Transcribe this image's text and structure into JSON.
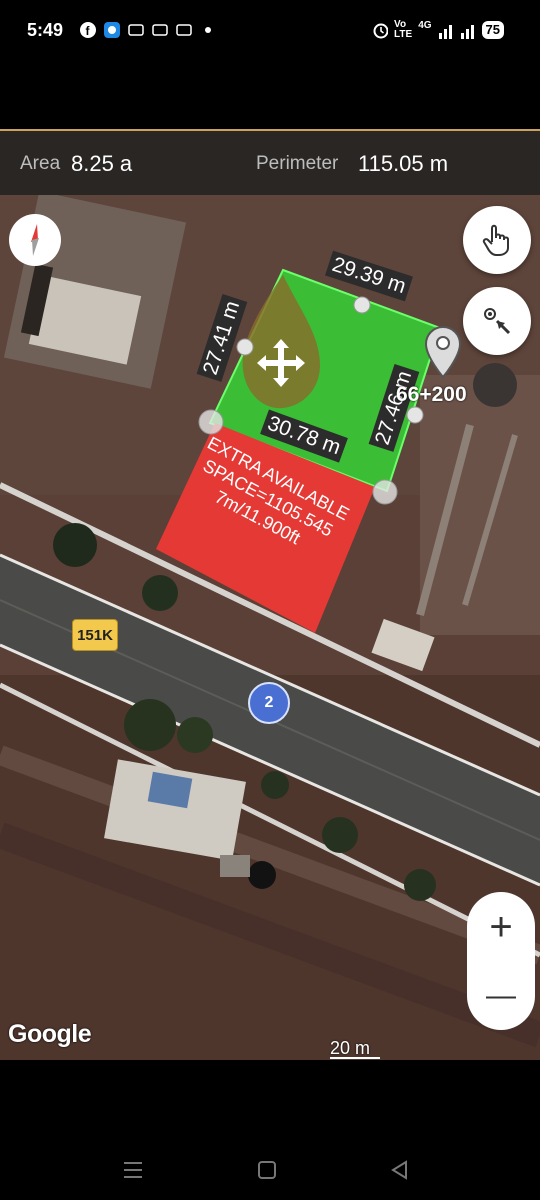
{
  "status": {
    "time": "5:49",
    "network_top": "Vo",
    "network_bottom": "LTE",
    "signal": "4G",
    "battery": "75",
    "icons": [
      "facebook-icon",
      "app-icon",
      "sms-icon",
      "sms-icon",
      "sms-icon",
      "dot-icon",
      "alarm-icon",
      "signal-icon",
      "signal-icon",
      "battery-icon"
    ]
  },
  "info": {
    "area_label": "Area",
    "area_value": "8.25 a",
    "perimeter_label": "Perimeter",
    "perimeter_value": "115.05 m"
  },
  "map": {
    "edge_top": "29.39 m",
    "edge_left": "27.41 m",
    "edge_right": "27.46 m",
    "edge_bottom": "30.78 m",
    "chainage": "66+200",
    "extra_note": "EXTRA AVAILABLE SPACE=1105.545 7m/11.900ft",
    "route_shield": "151K",
    "route_number": "2",
    "google_logo": "Google",
    "scale": "20 m",
    "polygon_color": "#2ecc2e",
    "note_color": "#e53935"
  },
  "controls": {
    "zoom_in": "+",
    "zoom_out": "—"
  }
}
